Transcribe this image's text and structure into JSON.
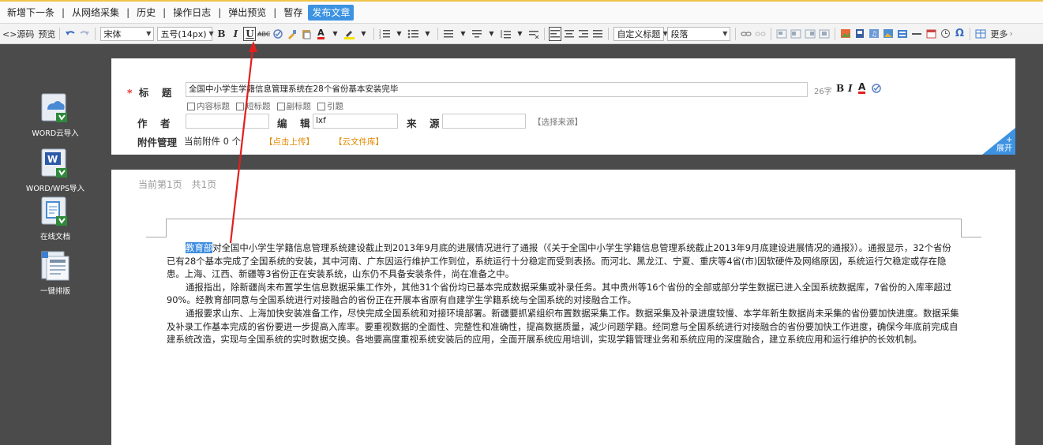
{
  "topbar": {
    "buttons": [
      "新增下一条",
      "从网络采集",
      "历史",
      "操作日志",
      "弹出预览",
      "暂存"
    ],
    "publish": "发布文章"
  },
  "toolbar": {
    "source": "<>源码",
    "preview": "预览",
    "font_family": "宋体",
    "font_size": "五号(14px)",
    "bold": "B",
    "italic": "I",
    "underline": "U",
    "font_color": "A",
    "custom_title": "自定义标题",
    "paragraph": "段落",
    "omega": "Ω",
    "more": "更多"
  },
  "sidebar": {
    "items": [
      {
        "label": "WORD云导入",
        "icon": "cloud-upload-icon"
      },
      {
        "label": "WORD/WPS导入",
        "icon": "word-import-icon"
      },
      {
        "label": "在线文档",
        "icon": "online-doc-icon"
      },
      {
        "label": "一键排版",
        "icon": "auto-layout-icon"
      }
    ]
  },
  "form": {
    "title_label": "标　题",
    "title_value": "全国中小学生学籍信息管理系统在28个省份基本安装完毕",
    "title_count": "26字",
    "title_bold": "B",
    "title_italic": "I",
    "title_color": "A",
    "options": [
      "内容标题",
      "短标题",
      "副标题",
      "引题"
    ],
    "author_label": "作　者",
    "author_value": "",
    "editor_label": "编　辑",
    "editor_value": "lxf",
    "source_label": "来　源",
    "source_value": "",
    "choose_source": "【选择来源】",
    "attachment_label": "附件管理",
    "current_attachments": "当前附件",
    "attachment_count": "0",
    "attachment_unit": "个",
    "upload": "【点击上传】",
    "cloud_library": "【云文件库】",
    "expand": "展开"
  },
  "doc": {
    "current_page": "当前第1页",
    "total_pages": "共1页",
    "p1_highlight": "教育部",
    "p1_rest": "对全国中小学生学籍信息管理系统建设截止到2013年9月底的进展情况进行了通报（《关于全国中小学生学籍信息管理系统截止2013年9月底建设进展情况的通报》）。通报显示，32个省份已有28个基本完成了全国系统的安装，其中河南、广东因运行维护工作到位，系统运行十分稳定而受到表扬。而河北、黑龙江、宁夏、重庆等4省(市)因软硬件及网络原因，系统运行欠稳定或存在隐患。上海、江西、新疆等3省份正在安装系统，山东仍不具备安装条件，尚在准备之中。",
    "p2": "通报指出，除新疆尚未布置学生信息数据采集工作外，其他31个省份均已基本完成数据采集或补录任务。其中贵州等16个省份的全部或部分学生数据已进入全国系统数据库，7省份的入库率超过90%。经教育部同意与全国系统进行对接融合的省份正在开展本省原有自建学生学籍系统与全国系统的对接融合工作。",
    "p3": "通报要求山东、上海加快安装准备工作，尽快完成全国系统和对接环境部署。新疆要抓紧组织布置数据采集工作。数据采集及补录进度较慢、本学年新生数据尚未采集的省份要加快进度。数据采集及补录工作基本完成的省份要进一步提高入库率。要重视数据的全面性、完整性和准确性，提高数据质量，减少问题学籍。经同意与全国系统进行对接融合的省份要加快工作进度，确保今年底前完成自建系统改造，实现与全国系统的实时数据交换。各地要高度重视系统安装后的应用，全面开展系统应用培训，实现学籍管理业务和系统应用的深度融合，建立系统应用和运行维护的长效机制。"
  },
  "colors": {
    "accent": "#3d93e2",
    "annotation_arrow": "#e0201e",
    "orange_link": "#e08a00"
  }
}
